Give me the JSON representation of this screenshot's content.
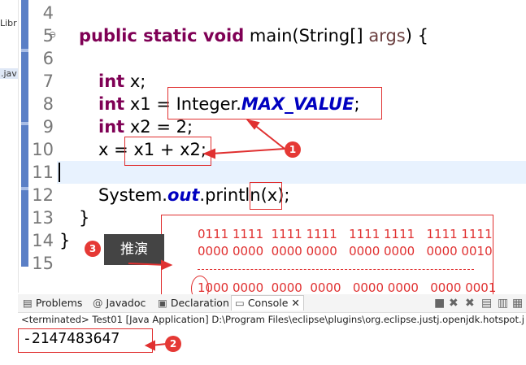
{
  "left_panel": {
    "item1": "Libr",
    "item2": ".jav"
  },
  "line_numbers": [
    "4",
    "5",
    "6",
    "7",
    "8",
    "9",
    "10",
    "11",
    "12",
    "13",
    "14",
    "15"
  ],
  "code": {
    "l5": {
      "kw": "public static void",
      "rest": " main(String[] ",
      "param": "args",
      "end": ") {"
    },
    "l7": {
      "kw": "int",
      "rest": " x;"
    },
    "l8": {
      "kw": "int",
      "rest": " x1 = ",
      "cls": "Integer.",
      "field": "MAX_VALUE",
      "end": ";"
    },
    "l9": {
      "kw": "int",
      "rest": " x2 = 2;"
    },
    "l10": {
      "text": "x = x1 + x2;"
    },
    "l12": {
      "pre": "System.",
      "field": "out",
      "post": ".println(x);"
    },
    "l13": "}",
    "l14": "}"
  },
  "annotations": {
    "badge1": "1",
    "badge2": "2",
    "badge3": "3",
    "tooltip": "推演",
    "binary": {
      "row1": "0111 1111  1111 1111   1111 1111   1111 1111",
      "row2": "0000 0000  0000 0000   0000 0000   0000 0010",
      "row3": "1000 0000  0000  0000   0000 0000   0000 0001"
    },
    "accent_color": "#e03030"
  },
  "tabs": {
    "problems": "Problems",
    "javadoc": "Javadoc",
    "declaration": "Declaration",
    "console": "Console"
  },
  "console": {
    "terminated": "<terminated> Test01 [Java Application] D:\\Program Files\\eclipse\\plugins\\org.eclipse.justj.openjdk.hotspot.j",
    "output": "-2147483647"
  }
}
